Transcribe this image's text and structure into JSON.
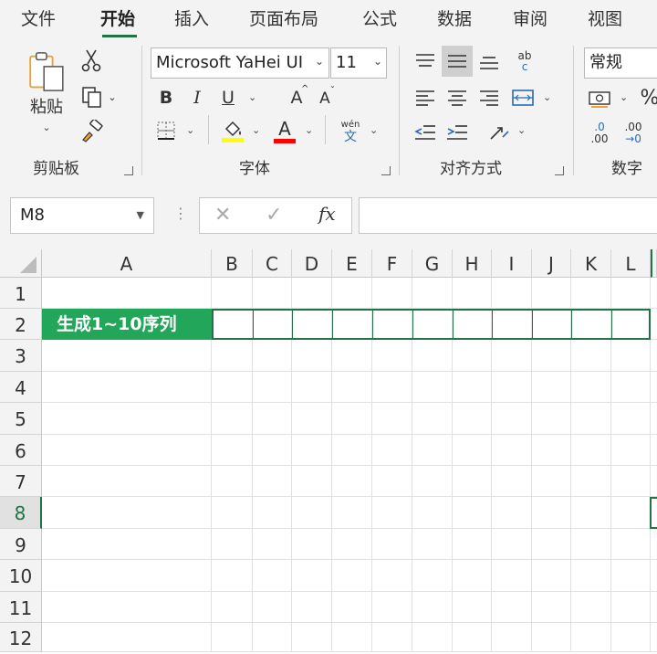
{
  "tabs": [
    {
      "label": "文件",
      "active": false
    },
    {
      "label": "开始",
      "active": true
    },
    {
      "label": "插入",
      "active": false
    },
    {
      "label": "页面布局",
      "active": false
    },
    {
      "label": "公式",
      "active": false
    },
    {
      "label": "数据",
      "active": false
    },
    {
      "label": "审阅",
      "active": false
    },
    {
      "label": "视图",
      "active": false
    }
  ],
  "ribbon": {
    "clipboard": {
      "group_label": "剪贴板",
      "paste_label": "粘贴"
    },
    "font": {
      "group_label": "字体",
      "font_name": "Microsoft YaHei UI",
      "font_size": "11",
      "bold": "B",
      "italic": "I",
      "underline": "U",
      "grow": "A",
      "shrink": "A",
      "font_color_glyph": "A",
      "wen_top": "wén",
      "wen_bottom": "文",
      "fill_color": "#ffff00",
      "font_color": "#ff0000"
    },
    "alignment": {
      "group_label": "对齐方式",
      "wrap_glyph_top": "ab",
      "wrap_glyph_bottom": "c"
    },
    "number": {
      "group_label": "数字",
      "format": "常规",
      "percent": "%",
      "inc_top": ".0",
      "inc_bottom": ".00",
      "dec_top": ".00",
      "dec_bottom": "→0"
    }
  },
  "formula_bar": {
    "name_box": "M8",
    "fx_label": "fx",
    "formula": ""
  },
  "sheet": {
    "columns": [
      "A",
      "B",
      "C",
      "D",
      "E",
      "F",
      "G",
      "H",
      "I",
      "J",
      "K",
      "L"
    ],
    "rows": [
      "1",
      "2",
      "3",
      "4",
      "5",
      "6",
      "7",
      "8",
      "9",
      "10",
      "11",
      "12"
    ],
    "selected_row": "8",
    "cell_A2": {
      "text": "生成1~10序列",
      "fill": "#22a65a",
      "color": "#ffffff"
    },
    "accent": "#217346"
  }
}
